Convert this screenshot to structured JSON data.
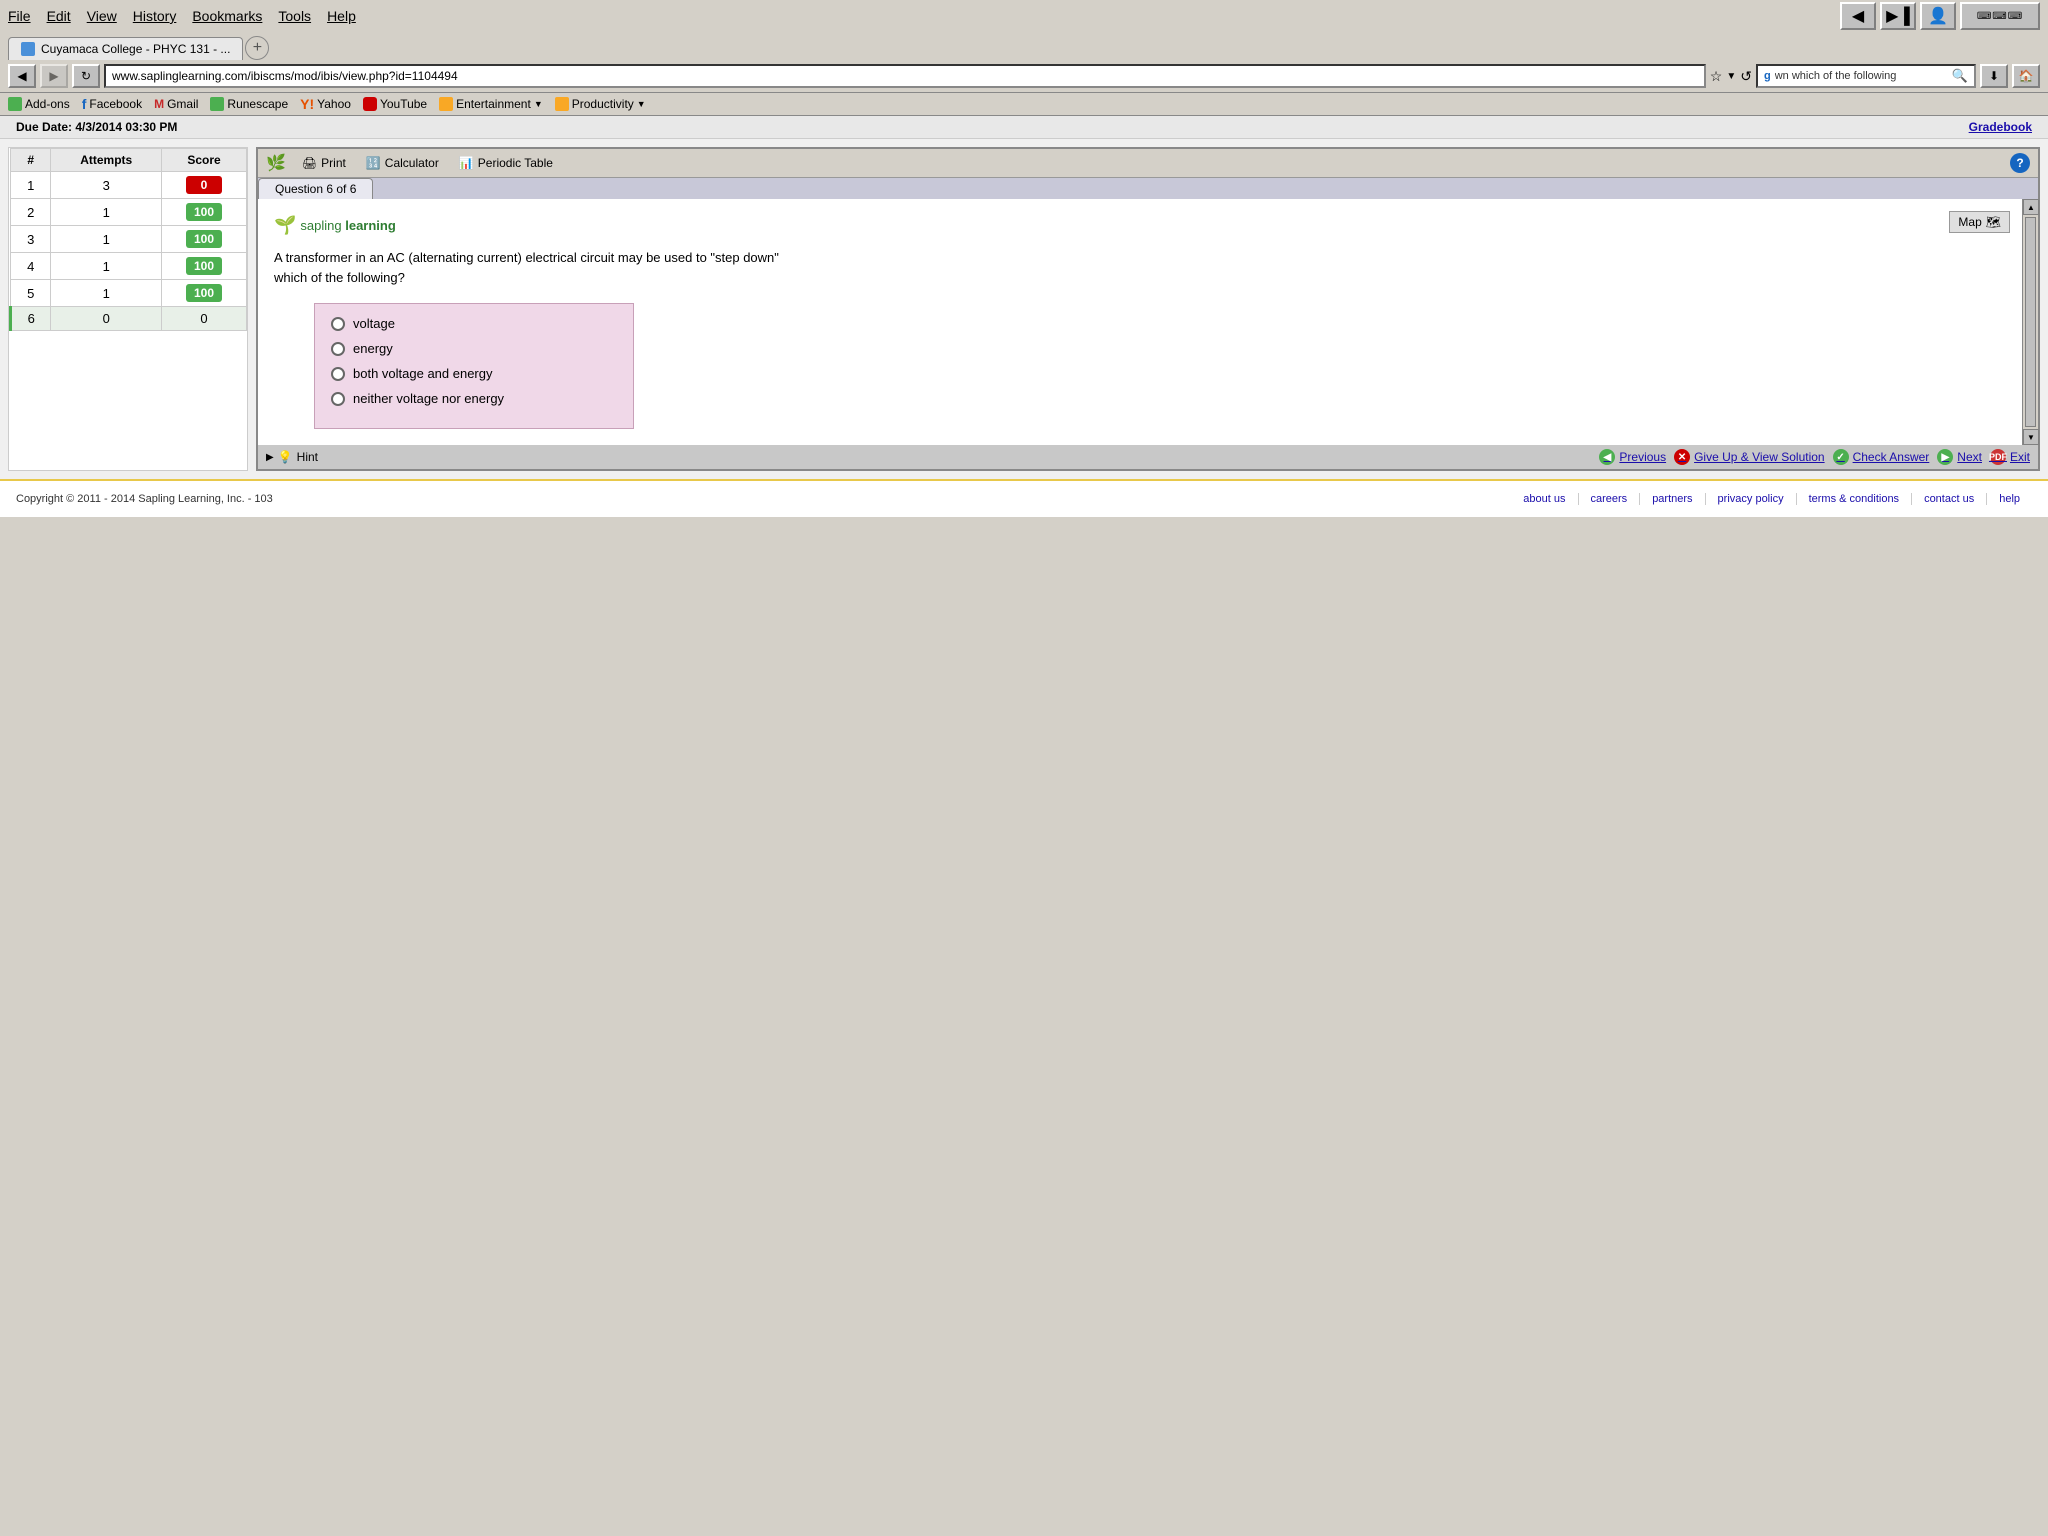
{
  "browser": {
    "menu_items": [
      "File",
      "Edit",
      "View",
      "History",
      "Bookmarks",
      "Tools",
      "Help"
    ],
    "tab_title": "Cuyamaca College - PHYC 131 - ...",
    "url": "www.saplinglearning.com/ibiscms/mod/ibis/view.php?id=1104494",
    "search_placeholder": "wn which of the following",
    "bookmarks": [
      {
        "label": "Add-ons",
        "icon": "green"
      },
      {
        "label": "Facebook",
        "icon": "blue"
      },
      {
        "label": "Gmail",
        "icon": "red"
      },
      {
        "label": "Runescape",
        "icon": "green"
      },
      {
        "label": "Yahoo",
        "icon": "orange"
      },
      {
        "label": "YouTube",
        "icon": "youtube"
      },
      {
        "label": "Entertainment",
        "icon": "folder"
      },
      {
        "label": "Productivity",
        "icon": "folder"
      }
    ]
  },
  "due_date_bar": {
    "text": "Due Date: 4/3/2014 03:30 PM",
    "gradebook": "Gradebook"
  },
  "attempts_table": {
    "headers": [
      "#",
      "Attempts",
      "Score"
    ],
    "rows": [
      {
        "num": "1",
        "attempts": "3",
        "score": "0",
        "score_type": "red"
      },
      {
        "num": "2",
        "attempts": "1",
        "score": "100",
        "score_type": "green"
      },
      {
        "num": "3",
        "attempts": "1",
        "score": "100",
        "score_type": "green"
      },
      {
        "num": "4",
        "attempts": "1",
        "score": "100",
        "score_type": "green"
      },
      {
        "num": "5",
        "attempts": "1",
        "score": "100",
        "score_type": "green"
      },
      {
        "num": "6",
        "attempts": "0",
        "score": "0",
        "score_type": "plain",
        "selected": true
      }
    ]
  },
  "question_toolbar": {
    "print": "Print",
    "calculator": "Calculator",
    "periodic_table": "Periodic Table",
    "help": "?"
  },
  "question_tab": {
    "label": "Question 6 of 6"
  },
  "question": {
    "map_btn": "Map",
    "text_line1": "A transformer in an AC (alternating current) electrical circuit may be used to \"step down\"",
    "text_line2": "which of the following?",
    "choices": [
      {
        "label": "voltage"
      },
      {
        "label": "energy"
      },
      {
        "label": "both voltage and energy"
      },
      {
        "label": "neither voltage nor energy"
      }
    ]
  },
  "bottom_bar": {
    "hint": "Hint",
    "previous": "Previous",
    "give_up": "Give Up & View Solution",
    "check_answer": "Check Answer",
    "next": "Next",
    "exit": "Exit"
  },
  "footer": {
    "copyright": "Copyright © 2011 - 2014 Sapling Learning, Inc. - 103",
    "links": [
      "about us",
      "careers",
      "partners",
      "privacy policy",
      "terms & conditions",
      "contact us",
      "help"
    ]
  }
}
